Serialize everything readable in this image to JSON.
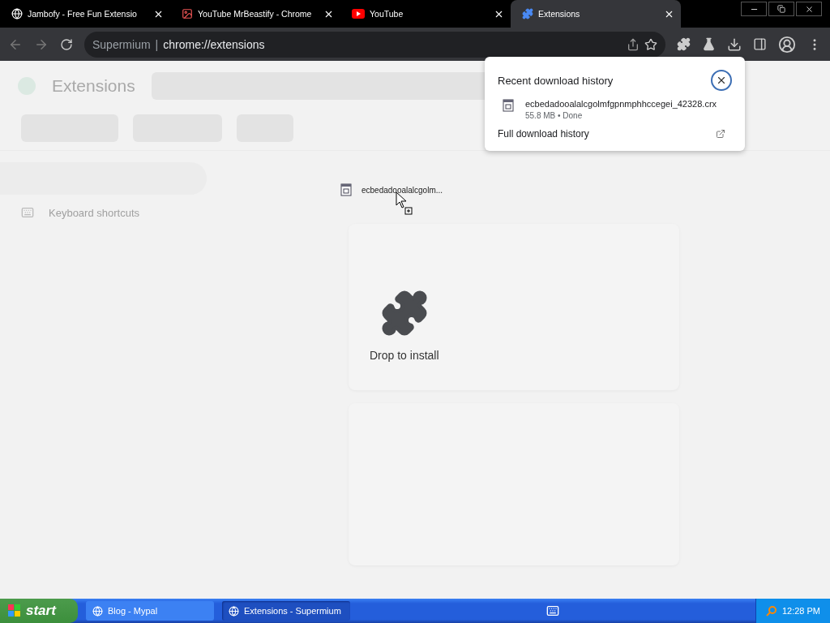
{
  "tabs": [
    {
      "title": "Jambofy - Free Fun Extensio",
      "kind": "globe",
      "selected": false
    },
    {
      "title": "YouTube MrBeastify - Chrome",
      "kind": "image",
      "selected": false
    },
    {
      "title": "YouTube",
      "kind": "youtube",
      "selected": false
    },
    {
      "title": "Extensions",
      "kind": "puzzle",
      "selected": true
    }
  ],
  "address_bar": {
    "site": "Supermium",
    "separator": "|",
    "url": "chrome://extensions"
  },
  "page": {
    "title": "Extensions",
    "sidebar": [
      {
        "label": "Keyboard shortcuts"
      }
    ]
  },
  "drag_item": {
    "name": "ecbedadooalalcgolm..."
  },
  "drop_overlay": {
    "label": "Drop to install"
  },
  "download_popup": {
    "title": "Recent download history",
    "items": [
      {
        "name": "ecbedadooalalcgolmfgpnmphhccegei_42328.crx",
        "status": "55.8 MB • Done"
      }
    ],
    "footer": "Full download history"
  },
  "taskbar": {
    "start": "start",
    "tasks": [
      {
        "label": "Blog - Mypal",
        "selected": false
      },
      {
        "label": "Extensions - Supermium",
        "selected": true
      }
    ],
    "clock": "12:28 PM"
  }
}
